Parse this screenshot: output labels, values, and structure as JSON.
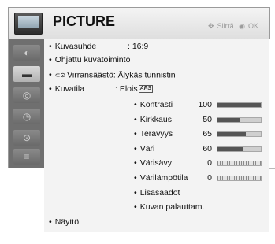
{
  "header": {
    "title": "PICTURE",
    "nav_move_label": "Siirrä",
    "nav_ok_label": "OK"
  },
  "sidebar": {
    "items": [
      {
        "icon": "picture-icon",
        "active": false
      },
      {
        "icon": "tv-icon",
        "active": true
      },
      {
        "icon": "sound-icon",
        "active": false
      },
      {
        "icon": "time-icon",
        "active": false
      },
      {
        "icon": "lock-icon",
        "active": false
      },
      {
        "icon": "option-icon",
        "active": false
      }
    ]
  },
  "menu": {
    "aspect_label": "Kuvasuhde",
    "aspect_value": ": 16:9",
    "guided_label": "Ohjattu kuvatoiminto",
    "energy_label": "Virransäästö: Älykäs tunnistin",
    "mode_label": "Kuvatila",
    "mode_value": ": Elois",
    "mode_badge": "APS",
    "display_label": "Näyttö"
  },
  "settings": [
    {
      "label": "Kontrasti",
      "value": "100",
      "level": 1.0,
      "style": "fill"
    },
    {
      "label": "Kirkkaus",
      "value": "50",
      "level": 0.5,
      "style": "fill"
    },
    {
      "label": "Terävyys",
      "value": "65",
      "level": 0.65,
      "style": "fill"
    },
    {
      "label": "Väri",
      "value": "60",
      "level": 0.6,
      "style": "fill"
    },
    {
      "label": "Värisävy",
      "value": "0",
      "level": 0.5,
      "style": "ticks"
    },
    {
      "label": "Värilämpötila",
      "value": "0",
      "level": 0.5,
      "style": "ticks"
    }
  ],
  "extra": {
    "advanced_label": "Lisäsäädöt",
    "reset_label": "Kuvan palauttam."
  },
  "colors": {
    "bar_fill": "#555555",
    "sidebar_bg": "#6f6f6f",
    "panel_bg": "#f3f3f3"
  }
}
